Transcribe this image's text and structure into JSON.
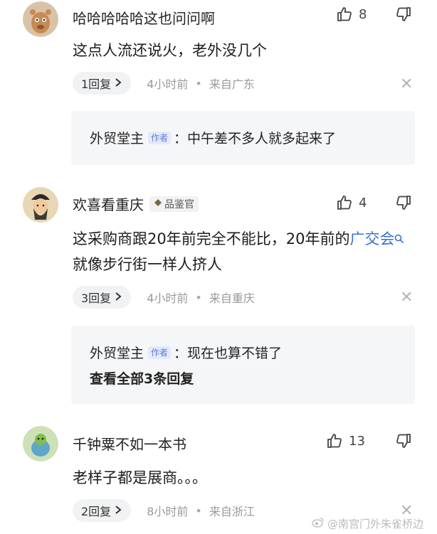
{
  "comments": [
    {
      "username": "哈哈哈哈哈这也问问啊",
      "like_count": "8",
      "text": "这点人流还说火，老外没几个",
      "reply_label": "1回复",
      "time": "4小时前",
      "location": "来自广东",
      "reply": {
        "author": "外贸堂主",
        "tag": "作者",
        "text": "：中午差不多人就多起来了"
      }
    },
    {
      "username": "欢喜看重庆",
      "badge": "品鉴官",
      "like_count": "4",
      "text_before_link": "这采购商跟20年前完全不能比，20年前的",
      "link_text": "广交会",
      "text_after_link": "就像步行街一样人挤人",
      "reply_label": "3回复",
      "time": "4小时前",
      "location": "来自重庆",
      "reply": {
        "author": "外贸堂主",
        "tag": "作者",
        "text": "：现在也算不错了"
      },
      "view_all": "查看全部3条回复"
    },
    {
      "username": "千钟粟不如一本书",
      "like_count": "13",
      "text": "老样子都是展商。。。",
      "reply_label": "2回复",
      "time": "8小时前",
      "location": "来自浙江"
    }
  ],
  "watermark": "@南宫门外朱雀桥边",
  "icons": {
    "like": "thumbs-up-icon",
    "dislike": "thumbs-down-icon",
    "close": "close-icon",
    "chevron": "chevron-right-icon",
    "search": "search-icon",
    "weibo": "weibo-logo-icon"
  },
  "colors": {
    "link": "#3a6fd8",
    "meta": "#9a9a9a",
    "reply_bg": "#f5f6f8"
  }
}
